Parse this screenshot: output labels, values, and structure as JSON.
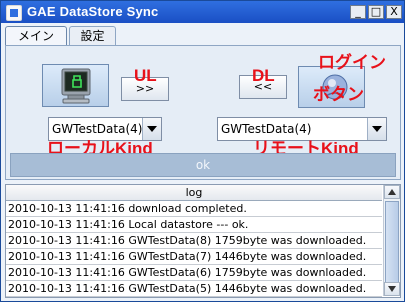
{
  "window": {
    "title": "GAE DataStore Sync"
  },
  "titlebar_buttons": {
    "minimize": "_",
    "maximize": "□",
    "close": "X"
  },
  "tabs": [
    {
      "label": "メイン"
    },
    {
      "label": "設定"
    }
  ],
  "buttons": {
    "upload": ">>",
    "download": "<<",
    "ok": "ok"
  },
  "annotations": {
    "ul": "UL",
    "dl": "DL",
    "login_line1": "ログイン",
    "login_line2": "ボタン",
    "local_kind": "ローカルKind",
    "remote_kind": "リモートKind",
    "color": "#e8111a"
  },
  "local_kind": {
    "selected": "GWTestData(4)"
  },
  "remote_kind": {
    "selected": "GWTestData(4)"
  },
  "log": {
    "header": "log",
    "rows": [
      "2010-10-13 11:41:16 download completed.",
      "2010-10-13 11:41:16 Local datastore --- ok.",
      "2010-10-13 11:41:16 GWTestData(8) 1759byte was downloaded.",
      "2010-10-13 11:41:16 GWTestData(7) 1446byte was downloaded.",
      "2010-10-13 11:41:16 GWTestData(6) 1759byte was downloaded.",
      "2010-10-13 11:41:16 GWTestData(5) 1446byte was downloaded."
    ]
  },
  "icons": {
    "app": "app-icon",
    "local_datastore": "computer-terminal-icon",
    "login": "google-account-icon",
    "dropdown": "chevron-down-icon",
    "scroll_up": "arrow-up-icon",
    "scroll_down": "arrow-down-icon"
  }
}
